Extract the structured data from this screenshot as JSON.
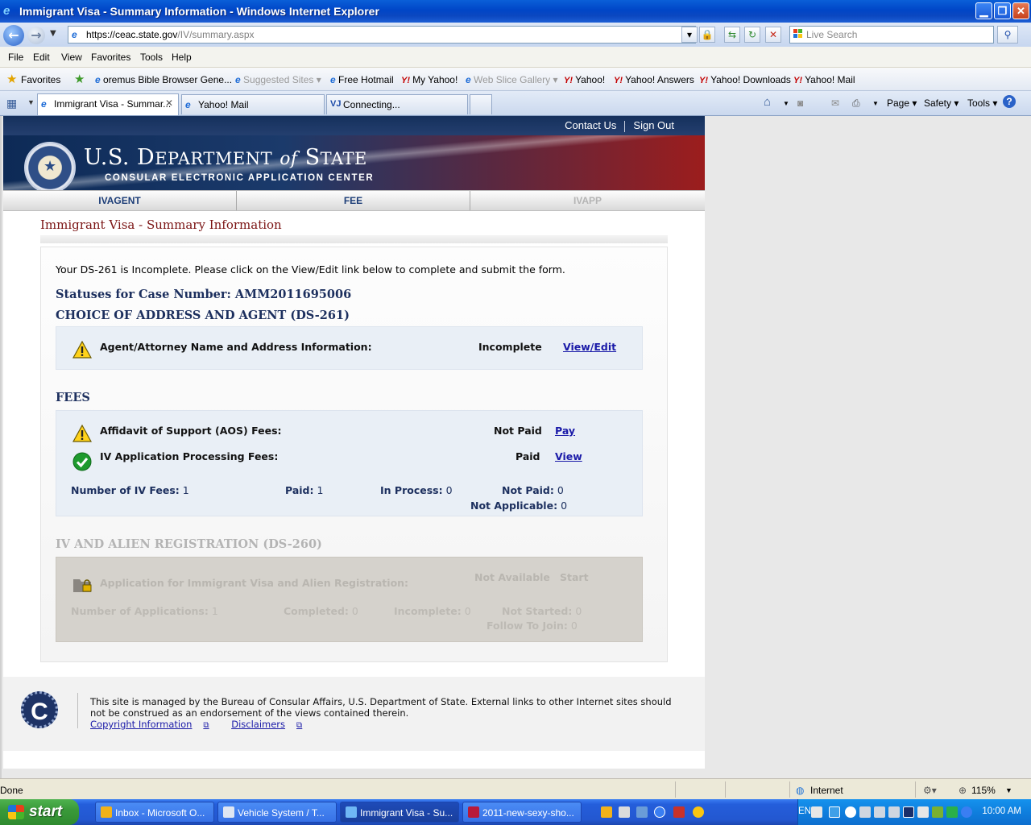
{
  "window": {
    "title": "Immigrant Visa - Summary Information - Windows Internet Explorer"
  },
  "address": {
    "prefix": "https://",
    "host": "ceac.state.gov",
    "path": "/IV/summary.aspx"
  },
  "search": {
    "placeholder": "Live Search"
  },
  "menu": [
    "File",
    "Edit",
    "View",
    "Favorites",
    "Tools",
    "Help"
  ],
  "favorites": {
    "label": "Favorites",
    "items": [
      "oremus Bible Browser  Gene...",
      "Suggested Sites ▾",
      "Free Hotmail",
      "My Yahoo!",
      "Web Slice Gallery ▾",
      "Yahoo!",
      "Yahoo! Answers",
      "Yahoo! Downloads",
      "Yahoo! Mail"
    ]
  },
  "tabs": [
    {
      "label": "Immigrant Visa - Summar..."
    },
    {
      "label": "Yahoo! Mail"
    },
    {
      "label": "Connecting..."
    }
  ],
  "commandbar": {
    "page": "Page ▾",
    "safety": "Safety ▾",
    "tools": "Tools ▾"
  },
  "site": {
    "contact": "Contact Us",
    "signout": "Sign Out",
    "dept_a": "U.S. D",
    "dept_b": "EPARTMENT",
    "dept_of": "of",
    "dept_c": "S",
    "dept_d": "TATE",
    "center": "CONSULAR ELECTRONIC APPLICATION CENTER",
    "nav": [
      "IVAGENT",
      "FEE",
      "IVAPP"
    ]
  },
  "main": {
    "title": "Immigrant Visa - Summary Information",
    "message": "Your DS-261 is Incomplete. Please click on the View/Edit link below to complete and submit the form.",
    "status_heading": "Statuses for Case Number: AMM2011695006",
    "ds261": {
      "heading": "CHOICE OF ADDRESS AND AGENT (DS-261)",
      "label": "Agent/Attorney Name and Address Information:",
      "status": "Incomplete",
      "link": "View/Edit"
    },
    "fees": {
      "heading": "FEES",
      "aos_label": "Affidavit of Support (AOS) Fees:",
      "aos_status": "Not Paid",
      "aos_link": "Pay",
      "iv_label": "IV Application Processing Fees:",
      "iv_status": "Paid",
      "iv_link": "View",
      "num_label": "Number of IV Fees:",
      "num_value": "1",
      "paid_label": "Paid:",
      "paid_value": "1",
      "inproc_label": "In Process:",
      "inproc_value": "0",
      "notpaid_label": "Not Paid:",
      "notpaid_value": "0",
      "na_label": "Not Applicable:",
      "na_value": "0"
    },
    "ds260": {
      "heading": "IV AND ALIEN REGISTRATION (DS-260)",
      "label": "Application for Immigrant Visa and Alien Registration:",
      "status": "Not Available",
      "link": "Start",
      "num_label": "Number of Applications:",
      "num_value": "1",
      "completed_label": "Completed:",
      "completed_value": "0",
      "incomplete_label": "Incomplete:",
      "incomplete_value": "0",
      "notstarted_label": "Not Started:",
      "notstarted_value": "0",
      "ftj_label": "Follow To Join:",
      "ftj_value": "0"
    }
  },
  "footer": {
    "logo": "C",
    "text": "This site is managed by the Bureau of Consular Affairs, U.S. Department of State. External links to other Internet sites should not be construed as an endorsement of the views contained therein.",
    "copyright": "Copyright Information",
    "disclaimers": "Disclaimers"
  },
  "statusbar": {
    "left": "Done",
    "zone": "Internet",
    "zoom": "115%"
  },
  "taskbar": {
    "start": "start",
    "tasks": [
      "Inbox - Microsoft O...",
      "Vehicle System  /  T...",
      "Immigrant Visa - Su...",
      "2011-new-sexy-sho..."
    ],
    "lang": "EN",
    "clock": "10:00 AM"
  },
  "colors": {
    "title_red": "#7b1414",
    "heading_navy": "#1c2f5e",
    "link_blue": "#1a1aa8",
    "panel_blue": "#e9eff6",
    "panel_gray": "#d5d2cc"
  }
}
